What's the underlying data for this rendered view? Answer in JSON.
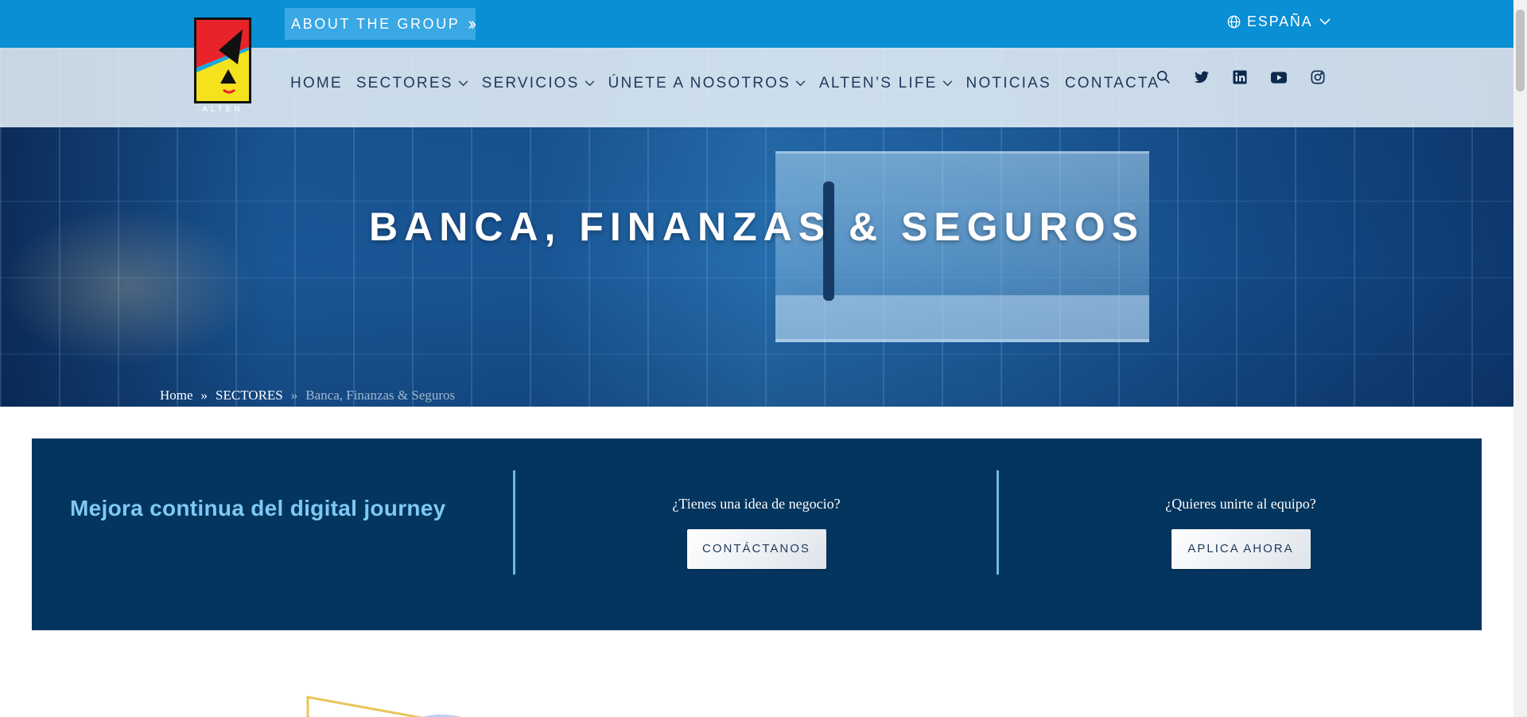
{
  "topbar": {
    "about_label": "ABOUT THE GROUP",
    "about_icon": "double-chevron-right-icon",
    "language_label": "ESPAÑA",
    "language_icon": "globe-icon"
  },
  "logo": {
    "wordmark": "ALTEN"
  },
  "nav": {
    "items": [
      {
        "label": "HOME",
        "dropdown": false
      },
      {
        "label": "SECTORES",
        "dropdown": true
      },
      {
        "label": "SERVICIOS",
        "dropdown": true
      },
      {
        "label": "ÚNETE A NOSOTROS",
        "dropdown": true
      },
      {
        "label": "ALTEN’S LIFE",
        "dropdown": true
      },
      {
        "label": "NOTICIAS",
        "dropdown": false
      },
      {
        "label": "CONTACTA",
        "dropdown": false
      }
    ],
    "icons": [
      "search-icon",
      "twitter-icon",
      "linkedin-icon",
      "youtube-icon",
      "instagram-icon"
    ]
  },
  "hero": {
    "title": "BANCA, FINANZAS & SEGUROS",
    "breadcrumb": {
      "home": "Home",
      "sectores": "SECTORES",
      "separator": "»",
      "current": "Banca, Finanzas & Seguros"
    }
  },
  "cta": {
    "headline": "Mejora continua del digital journey",
    "business": {
      "question": "¿Tienes una idea de negocio?",
      "button": "CONTÁCTANOS"
    },
    "join": {
      "question": "¿Quieres unirte al equipo?",
      "button": "APLICA AHORA"
    }
  },
  "colors": {
    "topbar": "#0a8ed4",
    "about_button": "#3aa8e4",
    "nav_text": "#203a5c",
    "cta_background": "#04355e",
    "cta_headline": "#7ec9f3"
  }
}
